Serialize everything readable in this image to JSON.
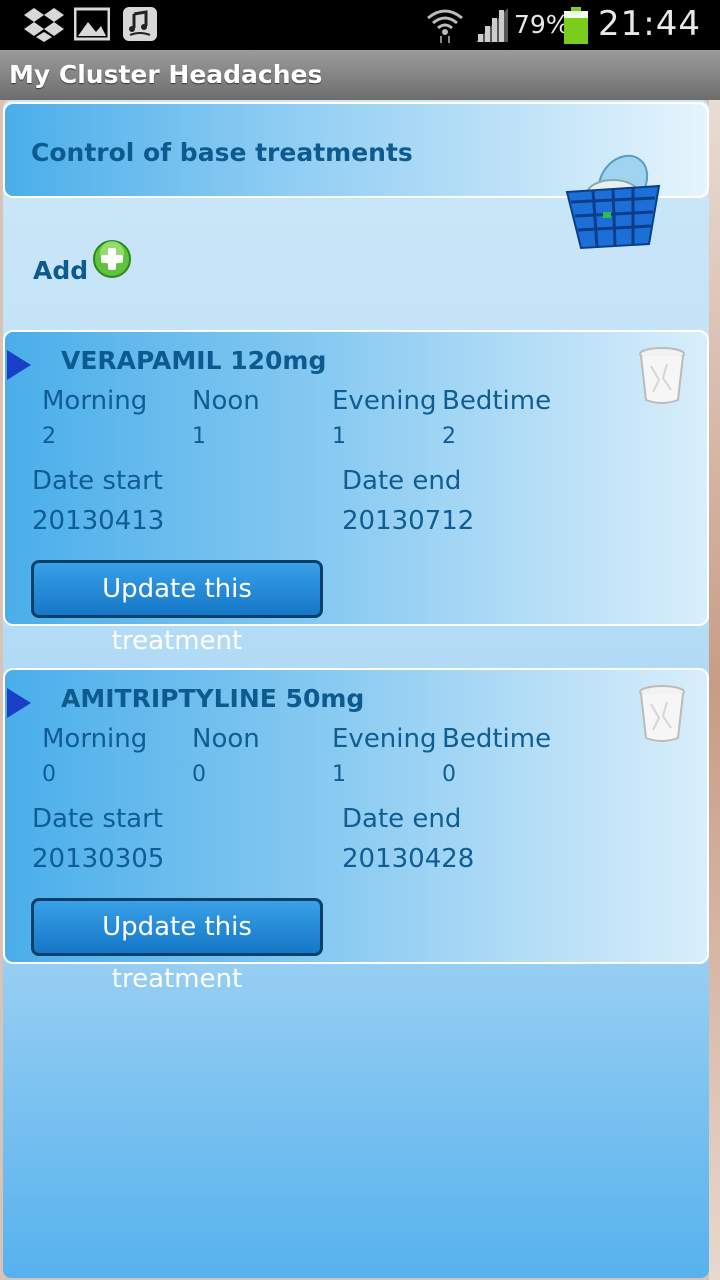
{
  "status_bar": {
    "battery_percent": "79%",
    "time": "21:44",
    "icons": [
      "dropbox-icon",
      "gallery-icon",
      "music-icon",
      "wifi-icon",
      "signal-icon",
      "battery-icon"
    ]
  },
  "app": {
    "title": "My Cluster Headaches"
  },
  "section": {
    "title": "Control of base treatments",
    "add_label": "Add"
  },
  "columns": {
    "morning": "Morning",
    "noon": "Noon",
    "evening": "Evening",
    "bedtime": "Bedtime",
    "date_start": "Date start",
    "date_end": "Date end"
  },
  "treatments": [
    {
      "name": "VERAPAMIL 120mg",
      "morning": "2",
      "noon": "1",
      "evening": "1",
      "bedtime": "2",
      "date_start": "20130413",
      "date_end": "20130712",
      "update_label": "Update this treatment"
    },
    {
      "name": "AMITRIPTYLINE 50mg",
      "morning": "0",
      "noon": "0",
      "evening": "1",
      "bedtime": "0",
      "date_start": "20130305",
      "date_end": "20130428",
      "update_label": "Update this treatment"
    }
  ],
  "colors": {
    "accent_text": "#0d5a8f",
    "button": "#1477c7",
    "battery": "#7ccc1d"
  }
}
